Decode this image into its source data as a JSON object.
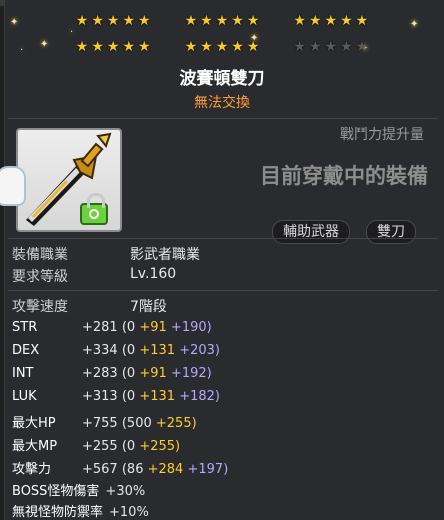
{
  "item": {
    "name": "波賽頓雙刀",
    "trade_status": "無法交換"
  },
  "star_groups": [
    {
      "filled": 5,
      "total": 5
    },
    {
      "filled": 5,
      "total": 5
    },
    {
      "filled": 5,
      "total": 5
    },
    {
      "filled": 5,
      "total": 5
    },
    {
      "filled": 5,
      "total": 5
    },
    {
      "filled": 0,
      "total": 5
    }
  ],
  "combat_power_label": "戰鬥力提升量",
  "equipped_text": "目前穿戴中的裝備",
  "tags": [
    "輔助武器",
    "雙刀"
  ],
  "requirements": [
    {
      "label": "裝備職業",
      "value": "影武者職業"
    },
    {
      "label": "要求等級",
      "value": "Lv.160"
    }
  ],
  "attack_speed": {
    "label": "攻擊速度",
    "value": "7階段"
  },
  "stats": [
    {
      "label": "STR",
      "total": "+281",
      "base": "(0",
      "bonus1": "+91",
      "bonus2": "+190)"
    },
    {
      "label": "DEX",
      "total": "+334",
      "base": "(0",
      "bonus1": "+131",
      "bonus2": "+203)"
    },
    {
      "label": "INT",
      "total": "+283",
      "base": "(0",
      "bonus1": "+91",
      "bonus2": "+192)"
    },
    {
      "label": "LUK",
      "total": "+313",
      "base": "(0",
      "bonus1": "+131",
      "bonus2": "+182)"
    },
    {
      "label": "最大HP",
      "total": "+755",
      "base": "(500",
      "bonus1": "+255)",
      "bonus2": ""
    },
    {
      "label": "最大MP",
      "total": "+255",
      "base": "(0",
      "bonus1": "+255)",
      "bonus2": ""
    },
    {
      "label": "攻擊力",
      "total": "+567",
      "base": "(86",
      "bonus1": "+284",
      "bonus2": "+197)"
    }
  ],
  "extra_stats": [
    {
      "label": "BOSS怪物傷害",
      "value": "+30%"
    },
    {
      "label": "無視怪物防禦率",
      "value": "+10%"
    }
  ],
  "colors": {
    "title": "#ffffff",
    "trade_status": "#ff9d3a",
    "bonus_yellow": "#ffcc33",
    "bonus_purple": "#b9a6ff",
    "star": "#f7c92a"
  }
}
